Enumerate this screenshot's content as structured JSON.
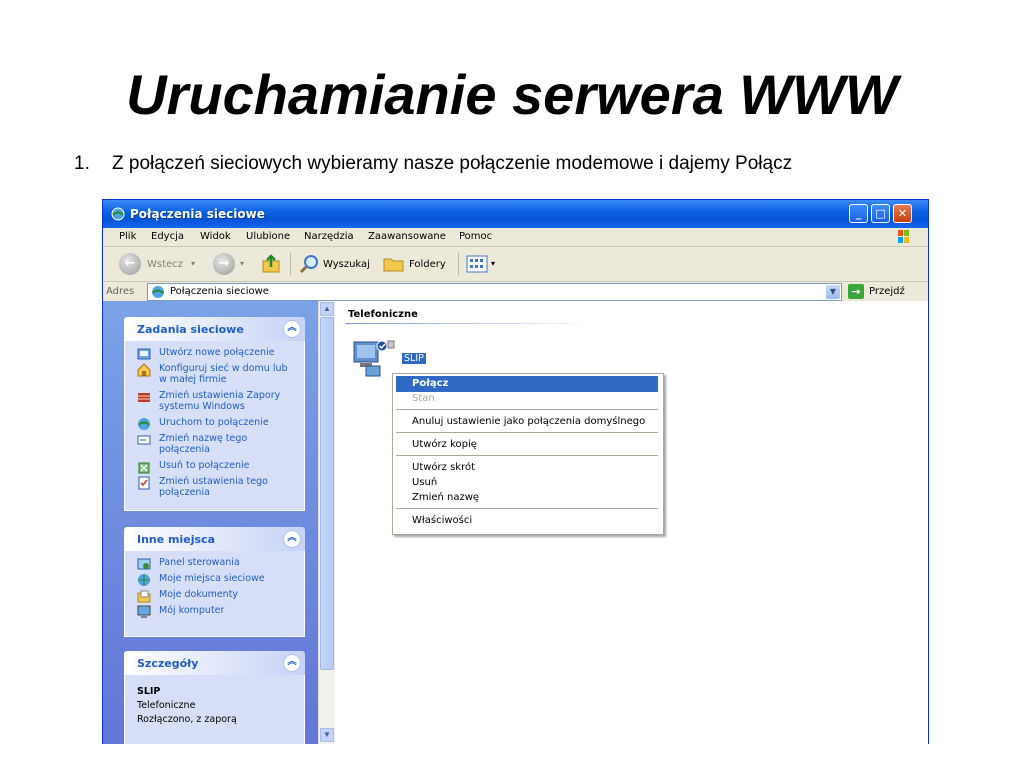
{
  "slide": {
    "title": "Uruchamianie serwera WWW",
    "bullet_number": "1.",
    "bullet_text": "Z połączeń sieciowych wybieramy nasze połączenie modemowe i dajemy Połącz"
  },
  "window": {
    "title": "Połączenia sieciowe",
    "menu": [
      "Plik",
      "Edycja",
      "Widok",
      "Ulubione",
      "Narzędzia",
      "Zaawansowane",
      "Pomoc"
    ],
    "toolbar": {
      "back_label": "Wstecz",
      "search_label": "Wyszukaj",
      "folders_label": "Foldery"
    },
    "address": {
      "label": "Adres",
      "value": "Połączenia sieciowe",
      "go_label": "Przejdź"
    }
  },
  "sidebar": {
    "network_tasks": {
      "title": "Zadania sieciowe",
      "items": [
        "Utwórz nowe połączenie",
        "Konfiguruj sieć w domu lub w małej firmie",
        "Zmień ustawienia Zapory systemu Windows",
        "Uruchom to połączenie",
        "Zmień nazwę tego połączenia",
        "Usuń to połączenie",
        "Zmień ustawienia tego połączenia"
      ]
    },
    "other_places": {
      "title": "Inne miejsca",
      "items": [
        "Panel sterowania",
        "Moje miejsca sieciowe",
        "Moje dokumenty",
        "Mój komputer"
      ]
    },
    "details": {
      "title": "Szczegóły",
      "name": "SLIP",
      "type": "Telefoniczne",
      "status": "Rozłączono, z zaporą"
    }
  },
  "content": {
    "group_title": "Telefoniczne",
    "connection_name": "SLIP"
  },
  "context_menu": {
    "connect": "Połącz",
    "status": "Stan",
    "cancel_default": "Anuluj ustawienie jako połączenia domyślnego",
    "create_copy": "Utwórz kopię",
    "create_shortcut": "Utwórz skrót",
    "delete": "Usuń",
    "rename": "Zmień nazwę",
    "properties": "Właściwości"
  },
  "colors": {
    "titlebar": "#0a5ee0",
    "selection": "#316ac5",
    "sidebar_link": "#215dc6"
  }
}
